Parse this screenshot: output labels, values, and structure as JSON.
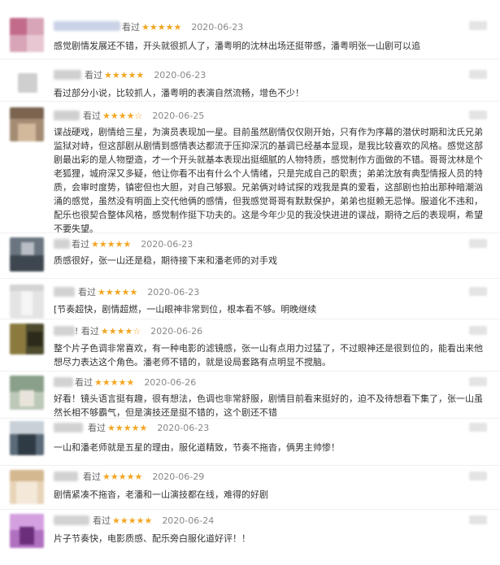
{
  "reviews": [
    {
      "status": "看过",
      "stars": "★★★★★",
      "date": "2020-06-23",
      "text": "感觉剧情发展还不错，开头就很抓人了，潘粤明的沈林出场还挺带感，潘粤明张一山剧可以追"
    },
    {
      "status": "看过",
      "stars": "★★★★★",
      "date": "2020-06-23",
      "text": "看过部分小说，比较抓人，潘粤明的表演自然流畅，增色不少！"
    },
    {
      "status": "看过",
      "stars": "★★★★☆",
      "date": "2020-06-25",
      "text": "谍战硬戏，剧情给三星，为演员表现加一星。目前虽然剧情仅仅刚开始，只有作为序幕的潜伏时期和沈氏兄弟监狱对峙，但这部剧从剧情到感情表达都流于压抑深沉的基调已经基本显现，是我比较喜欢的风格。感觉这部剧最出彩的是人物塑造，才一个开头就基本表现出挺细腻的人物特质，感觉制作方面做的不错。哥哥沈林是个老狐狸，城府深又多疑，他让你看不出有什么个人情绪，只是完成自己的职责；弟弟沈放有典型情报人员的特质，会审时度势，镇密但也大胆，对自己够狠。兄弟俩对峙试探的戏我是真的爱看，这部剧也拍出那种暗潮汹涌的感觉，虽然没有明面上交代他俩的感情，但我感觉哥哥有默默保护，弟弟也挺赖无忌惮。服道化不违和，配乐也很契合整体风格，感觉制作挺下功夫的。这是今年少见的我没快进进的谍战，期待之后的表现啊，希望不要失望。"
    },
    {
      "status": "看过",
      "stars": "★★★★★",
      "date": "2020-06-23",
      "text": "质感很好，张一山还是稳，期待接下来和潘老师的对手戏"
    },
    {
      "status": "看过",
      "stars": "★★★★★",
      "date": "2020-06-23",
      "text": "[节奏超快，剧情超燃，一山眼神非常到位，根本看不够。明晚继续"
    },
    {
      "status": "! 看过",
      "stars": "★★★★☆",
      "date": "2020-06-26",
      "text": "整个片子色调非常喜欢，有一种电影的滤镜感，张一山有点用力过猛了，不过眼神还是很到位的，能看出来他想尽力表达这个角色。潘老师不错的，就是设局套路有点明显不搅脑。"
    },
    {
      "status": "看过",
      "stars": "★★★★★",
      "date": "2020-06-26",
      "text": "好看！镜头语言挺有趣，很有想法，色调也非常舒服，剧情目前看来挺好的，迫不及待想看下集了，张一山虽然长相不够霸气，但是演技还是挺不错的，这个剧还不错"
    },
    {
      "status": "看过",
      "stars": "★★★★★",
      "date": "2020-06-23",
      "text": "一山和潘老师就是五星的理由，服化道精致，节奏不拖沓，俩男主帅惨！"
    },
    {
      "status": "看过",
      "stars": "★★★★★",
      "date": "2020-06-29",
      "text": "剧情紧凑不拖沓，老潘和一山演技都在线，难得的好剧"
    },
    {
      "status": "看过",
      "stars": "★★★★★",
      "date": "2020-06-24",
      "text": "片子节奏快，电影质感、配乐旁白服化道好评！！"
    }
  ]
}
